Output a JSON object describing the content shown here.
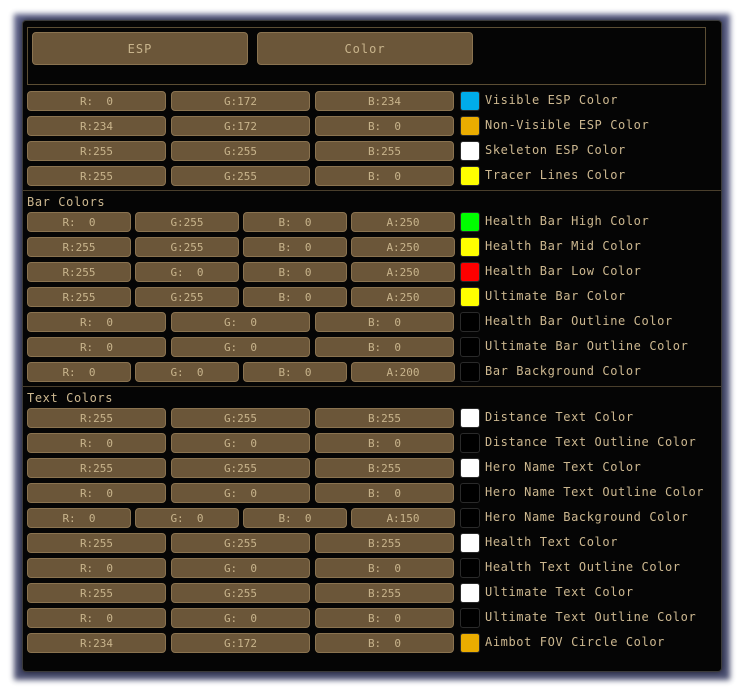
{
  "tabs": [
    {
      "label": "ESP"
    },
    {
      "label": "Color"
    }
  ],
  "colors": {
    "panel_bg": "#050505",
    "field_bg": "#6b5639",
    "field_border": "#8a7350",
    "text": "#c8b48c"
  },
  "esp_rows": [
    {
      "fields": [
        "R:  0",
        "G:172",
        "B:234"
      ],
      "swatch": "#00acea",
      "label": "Visible ESP Color"
    },
    {
      "fields": [
        "R:234",
        "G:172",
        "B:  0"
      ],
      "swatch": "#eaac00",
      "label": "Non-Visible ESP Color"
    },
    {
      "fields": [
        "R:255",
        "G:255",
        "B:255"
      ],
      "swatch": "#ffffff",
      "label": "Skeleton ESP Color"
    },
    {
      "fields": [
        "R:255",
        "G:255",
        "B:  0"
      ],
      "swatch": "#ffff00",
      "label": "Tracer Lines Color"
    }
  ],
  "bar_section": {
    "title": "Bar Colors",
    "rows": [
      {
        "fields": [
          "R:  0",
          "G:255",
          "B:  0",
          "A:250"
        ],
        "swatch": "#00ff00",
        "label": "Health Bar High Color"
      },
      {
        "fields": [
          "R:255",
          "G:255",
          "B:  0",
          "A:250"
        ],
        "swatch": "#ffff00",
        "label": "Health Bar Mid Color"
      },
      {
        "fields": [
          "R:255",
          "G:  0",
          "B:  0",
          "A:250"
        ],
        "swatch": "#ff0000",
        "label": "Health Bar Low Color"
      },
      {
        "fields": [
          "R:255",
          "G:255",
          "B:  0",
          "A:250"
        ],
        "swatch": "#ffff00",
        "label": "Ultimate Bar Color"
      },
      {
        "fields": [
          "R:  0",
          "G:  0",
          "B:  0"
        ],
        "swatch": "#000000",
        "label": "Health Bar Outline Color"
      },
      {
        "fields": [
          "R:  0",
          "G:  0",
          "B:  0"
        ],
        "swatch": "#000000",
        "label": "Ultimate Bar Outline Color"
      },
      {
        "fields": [
          "R:  0",
          "G:  0",
          "B:  0",
          "A:200"
        ],
        "swatch": "#000000",
        "label": "Bar Background Color"
      }
    ]
  },
  "text_section": {
    "title": "Text Colors",
    "rows": [
      {
        "fields": [
          "R:255",
          "G:255",
          "B:255"
        ],
        "swatch": "#ffffff",
        "label": "Distance Text Color"
      },
      {
        "fields": [
          "R:  0",
          "G:  0",
          "B:  0"
        ],
        "swatch": "#000000",
        "label": "Distance Text Outline Color"
      },
      {
        "fields": [
          "R:255",
          "G:255",
          "B:255"
        ],
        "swatch": "#ffffff",
        "label": "Hero Name Text Color"
      },
      {
        "fields": [
          "R:  0",
          "G:  0",
          "B:  0"
        ],
        "swatch": "#000000",
        "label": "Hero Name Text Outline Color"
      },
      {
        "fields": [
          "R:  0",
          "G:  0",
          "B:  0",
          "A:150"
        ],
        "swatch": "#000000",
        "label": "Hero Name Background Color"
      },
      {
        "fields": [
          "R:255",
          "G:255",
          "B:255"
        ],
        "swatch": "#ffffff",
        "label": "Health Text Color"
      },
      {
        "fields": [
          "R:  0",
          "G:  0",
          "B:  0"
        ],
        "swatch": "#000000",
        "label": "Health Text Outline Color"
      },
      {
        "fields": [
          "R:255",
          "G:255",
          "B:255"
        ],
        "swatch": "#ffffff",
        "label": "Ultimate Text Color"
      },
      {
        "fields": [
          "R:  0",
          "G:  0",
          "B:  0"
        ],
        "swatch": "#000000",
        "label": "Ultimate Text Outline Color"
      },
      {
        "fields": [
          "R:234",
          "G:172",
          "B:  0"
        ],
        "swatch": "#eaac00",
        "label": "Aimbot FOV Circle Color"
      }
    ]
  }
}
